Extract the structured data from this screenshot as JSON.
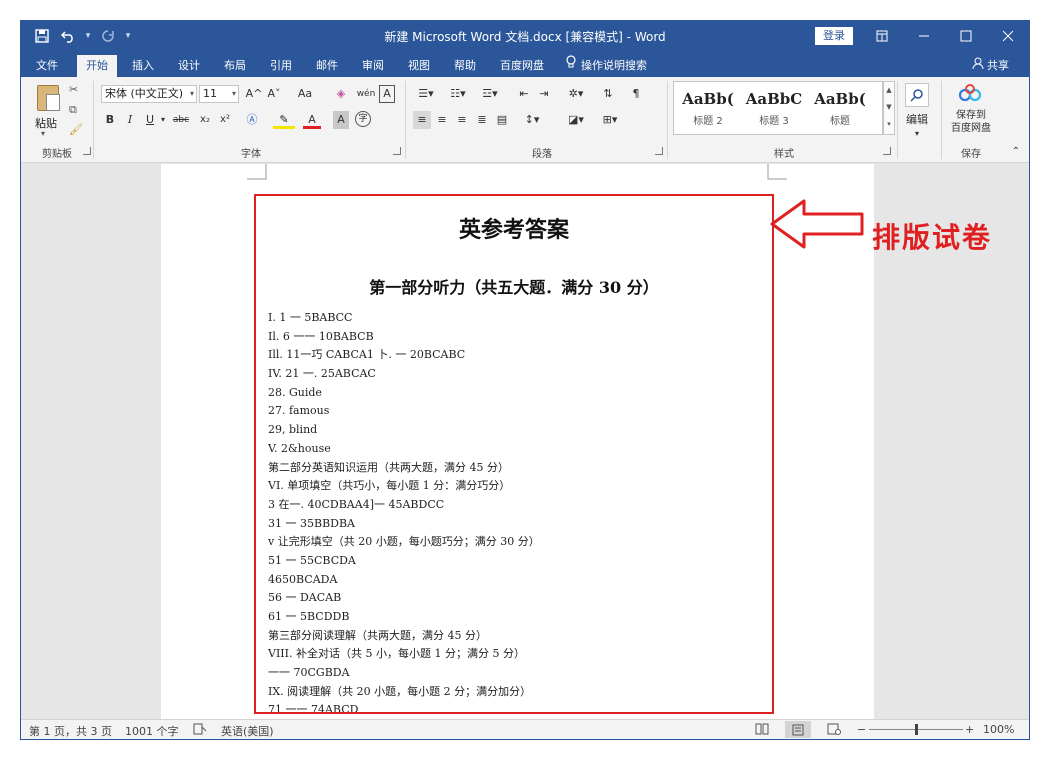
{
  "window": {
    "title": "新建 Microsoft Word 文档.docx [兼容模式] - Word",
    "login_label": "登录"
  },
  "qat": {
    "save_icon": "save-icon",
    "undo_icon": "undo-icon",
    "redo_icon": "redo-icon",
    "customize_icon": "customize-qat-icon"
  },
  "tabs": [
    {
      "label": "文件"
    },
    {
      "label": "开始"
    },
    {
      "label": "插入"
    },
    {
      "label": "设计"
    },
    {
      "label": "布局"
    },
    {
      "label": "引用"
    },
    {
      "label": "邮件"
    },
    {
      "label": "审阅"
    },
    {
      "label": "视图"
    },
    {
      "label": "帮助"
    },
    {
      "label": "百度网盘"
    },
    {
      "label": "操作说明搜索"
    }
  ],
  "active_tab": "开始",
  "share_label": "共享",
  "ribbon": {
    "clipboard": {
      "paste_label": "粘贴",
      "group_label": "剪贴板"
    },
    "font": {
      "font_name": "宋体 (中文正文)",
      "font_size": "11",
      "group_label": "字体",
      "bold": "B",
      "italic": "I",
      "underline": "U",
      "strikethrough": "abc",
      "subscript": "x₂",
      "superscript": "x²",
      "grow": "A^",
      "shrink": "A˅",
      "change_case": "Aa",
      "phonetic": "wén",
      "border_char": "A",
      "font_color": "A",
      "shade_char": "A",
      "enclose_char": "字"
    },
    "paragraph": {
      "group_label": "段落"
    },
    "styles": {
      "items": [
        {
          "sample": "AaBb(",
          "name": "标题 2"
        },
        {
          "sample": "AaBbC",
          "name": "标题 3"
        },
        {
          "sample": "AaBb(",
          "name": "标题"
        }
      ],
      "group_label": "样式"
    },
    "editing": {
      "label": "编辑"
    },
    "save": {
      "label_line1": "保存到",
      "label_line2": "百度网盘",
      "group_label": "保存"
    }
  },
  "document": {
    "title": "英参考答案",
    "subtitle": "第一部分听力（共五大题．满分 30 分）",
    "lines": [
      "I. 1 一 5BABCC",
      "Il. 6 一一 10BABCB",
      "Ill. 11一巧 CABCA1 卜. 一 20BCABC",
      "IV. 21 一. 25ABCAC",
      "28. Guide",
      "27. famous",
      "29, blind",
      "V. 2&house",
      "第二部分英语知识运用（共两大题，满分 45 分）",
      "VI. 单项填空（共巧小，每小题 1 分：满分巧分）",
      "3 在一. 40CDBAA4]一 45ABDCC",
      "31 一 35BBDBA",
      "v 让完形填空（共 20 小题，每小题巧分；满分 30 分）",
      "51 一 55CBCDA",
      "4650BCADA",
      "56 一 DACAB",
      "61 一 5BCDDB",
      "第三部分阅读理解（共两大题，满分 45 分）",
      "VIII. 补全对话（共 5 小，每小题 1 分；满分 5 分）",
      "一一 70CGBDA",
      "IX. 阅读理解（共 20 小题，每小题 2 分；满分加分）",
      "71 一一 74ABCD"
    ]
  },
  "annotation": {
    "text": "排版试卷",
    "color": "#e02020"
  },
  "status": {
    "page": "第 1 页，共 3 页",
    "words": "1001 个字",
    "language": "英语(美国)",
    "zoom": "100%",
    "zoom_level": 1.0
  },
  "colors": {
    "brand": "#2b579a",
    "highlight_box": "#e02020"
  }
}
